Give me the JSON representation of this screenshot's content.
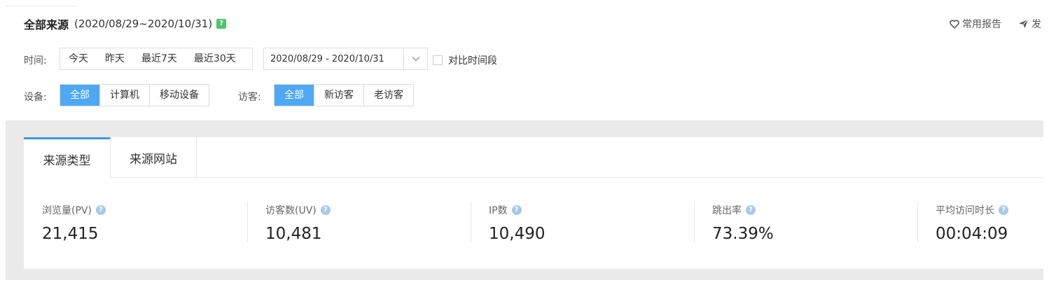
{
  "header": {
    "title": "全部来源",
    "date_range": "(2020/08/29~2020/10/31)",
    "help_icon": "question-icon",
    "actions": [
      {
        "label": "常用报告",
        "icon": "heart-icon"
      },
      {
        "label": "发",
        "icon": "send-icon"
      }
    ]
  },
  "filters": {
    "time": {
      "label": "时间:",
      "options": [
        "今天",
        "昨天",
        "最近7天",
        "最近30天"
      ],
      "range_value": "2020/08/29 - 2020/10/31",
      "compare_label": "对比时间段"
    },
    "device": {
      "label": "设备:",
      "options": [
        "全部",
        "计算机",
        "移动设备"
      ],
      "selected": "全部"
    },
    "visitor": {
      "label": "访客:",
      "options": [
        "全部",
        "新访客",
        "老访客"
      ],
      "selected": "全部"
    }
  },
  "tabs": [
    {
      "label": "来源类型",
      "active": true
    },
    {
      "label": "来源网站",
      "active": false
    }
  ],
  "metrics": [
    {
      "label": "浏览量(PV)",
      "value": "21,415"
    },
    {
      "label": "访客数(UV)",
      "value": "10,481"
    },
    {
      "label": "IP数",
      "value": "10,490"
    },
    {
      "label": "跳出率",
      "value": "73.39%"
    },
    {
      "label": "平均访问时长",
      "value": "00:04:09"
    }
  ],
  "colors": {
    "accent": "#4fa8f5",
    "tab_indicator": "#3b99ee",
    "help_green": "#52c46a",
    "help_blue": "#a9c8ec",
    "background_gray": "#eaeaea"
  }
}
